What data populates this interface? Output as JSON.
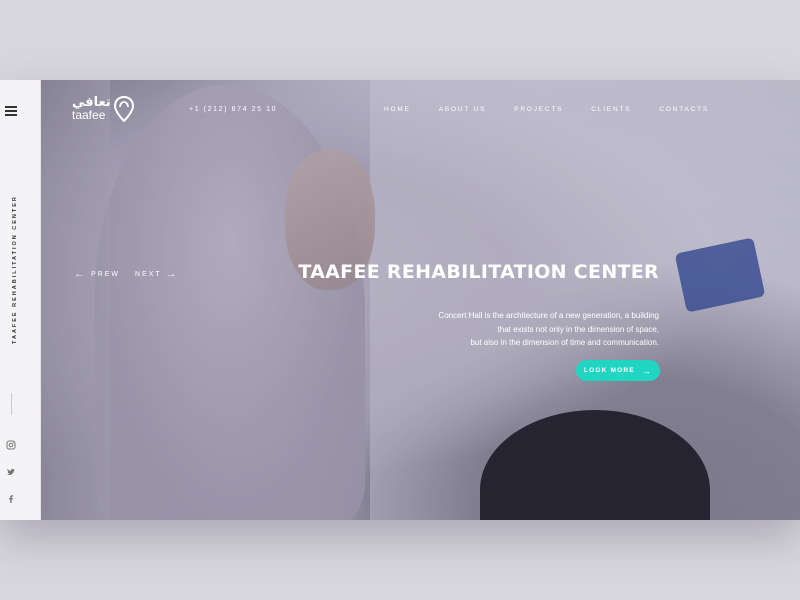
{
  "sidebar": {
    "vertical_text": "TAAFEE REHABILITATION CENTER",
    "menu_icon": "hamburger-icon",
    "social": [
      "instagram-icon",
      "twitter-icon",
      "facebook-icon"
    ]
  },
  "header": {
    "logo_arabic": "تعافي",
    "logo_latin": "taafee",
    "phone": "+1 (212) 674 25 10",
    "nav": [
      "HOME",
      "ABOUT US",
      "PROJECTS",
      "CLIENTS",
      "CONTACTS"
    ]
  },
  "slider": {
    "prev": "PREW",
    "next": "NEXT"
  },
  "hero": {
    "title": "TAAFEE REHABILITATION CENTER",
    "description_lines": [
      "Concert Hall is the architecture of a new generation, a building",
      "that exists not only in the dimension of space,",
      "but also in the dimension of time and communication."
    ],
    "button_label": "LOOK MORE"
  },
  "colors": {
    "accent": "#20d6c2",
    "background": "#d8d6dd",
    "sidebar": "#f4f4f6"
  }
}
